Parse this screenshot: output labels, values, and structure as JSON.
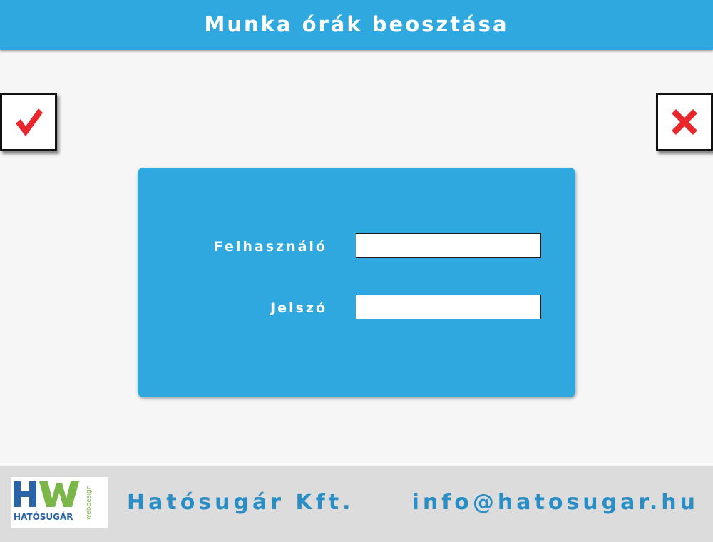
{
  "header": {
    "title": "Munka órák beosztása"
  },
  "toolbar": {
    "confirm_icon": "checkmark-icon",
    "cancel_icon": "close-icon",
    "confirm_color": "#e8262b",
    "cancel_color": "#e8262b"
  },
  "login": {
    "username_label": "Felhasználó",
    "username_value": "",
    "password_label": "Jelszó",
    "password_value": ""
  },
  "footer": {
    "logo": {
      "letters": "HW",
      "brand": "HATÓSUGÁR",
      "tagline": "webdesign"
    },
    "company": "Hatósugár Kft.",
    "email": "info@hatosugar.hu"
  },
  "colors": {
    "accent": "#2fa8e0",
    "footer_bg": "#dcdcdc",
    "footer_text": "#2a8ec6"
  }
}
